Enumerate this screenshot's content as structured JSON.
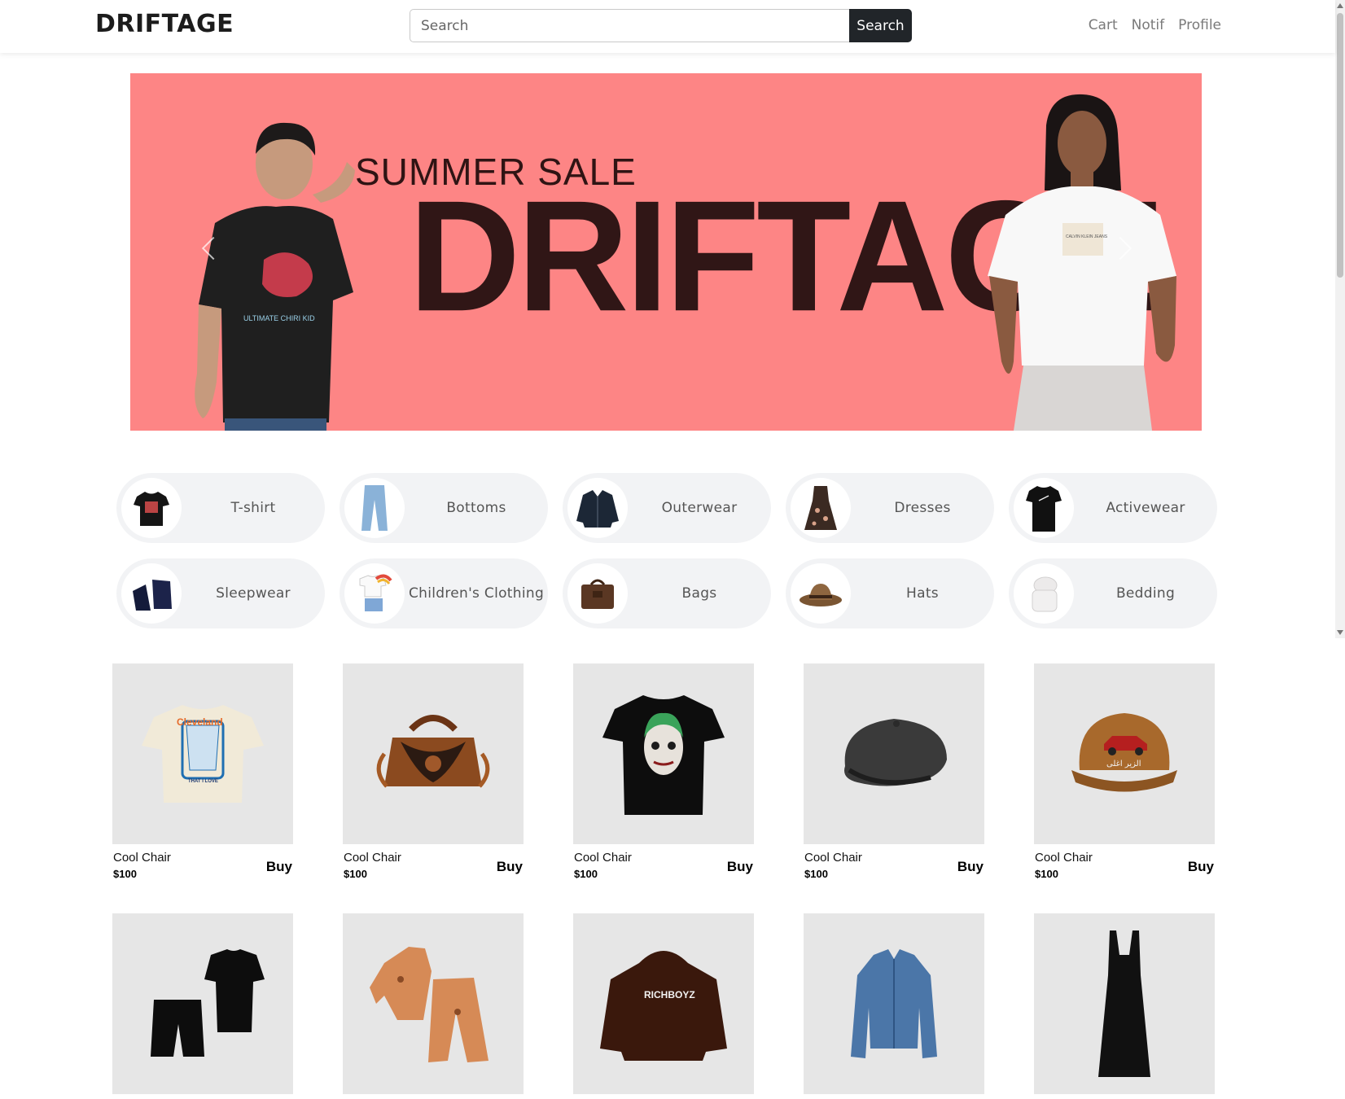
{
  "header": {
    "brand": "DRIFTAGE",
    "search_placeholder": "Search",
    "search_button": "Search",
    "links": [
      "Cart",
      "Notif",
      "Profile"
    ]
  },
  "hero": {
    "subtitle": "SUMMER SALE",
    "title": "DRIFTAGE",
    "background": "#fd8585",
    "left_shirt_text": "ULTIMATE CHIRI KID",
    "right_shirt_text": "CALVIN KLEIN JEANS"
  },
  "categories": [
    {
      "label": "T-shirt",
      "icon": "tshirt-icon"
    },
    {
      "label": "Bottoms",
      "icon": "jeans-icon"
    },
    {
      "label": "Outerwear",
      "icon": "jacket-icon"
    },
    {
      "label": "Dresses",
      "icon": "dress-icon"
    },
    {
      "label": "Activewear",
      "icon": "activewear-icon"
    },
    {
      "label": "Sleepwear",
      "icon": "sleepwear-icon"
    },
    {
      "label": "Children's Clothing",
      "icon": "kids-clothing-icon"
    },
    {
      "label": "Bags",
      "icon": "bag-icon"
    },
    {
      "label": "Hats",
      "icon": "hat-icon"
    },
    {
      "label": "Bedding",
      "icon": "bedding-icon"
    }
  ],
  "products": [
    {
      "name": "Cool Chair",
      "price": "$100",
      "buy": "Buy",
      "image": "cream-graphic-tshirt"
    },
    {
      "name": "Cool Chair",
      "price": "$100",
      "buy": "Buy",
      "image": "paisley-handbag"
    },
    {
      "name": "Cool Chair",
      "price": "$100",
      "buy": "Buy",
      "image": "joker-tshirt"
    },
    {
      "name": "Cool Chair",
      "price": "$100",
      "buy": "Buy",
      "image": "flat-cap"
    },
    {
      "name": "Cool Chair",
      "price": "$100",
      "buy": "Buy",
      "image": "corduroy-cap"
    },
    {
      "name": "",
      "price": "",
      "buy": "",
      "image": "sports-set"
    },
    {
      "name": "",
      "price": "",
      "buy": "",
      "image": "pajama-set"
    },
    {
      "name": "",
      "price": "",
      "buy": "",
      "image": "richboyz-hoodie"
    },
    {
      "name": "",
      "price": "",
      "buy": "",
      "image": "denim-jacket"
    },
    {
      "name": "",
      "price": "",
      "buy": "",
      "image": "black-dress"
    }
  ],
  "product_texts": {
    "cap_arabic": "الزير اغلى",
    "hoodie_text": "RICHBOYZ",
    "tshirt_text": "THAT I LOVE",
    "tshirt_brand": "Cleveland"
  }
}
